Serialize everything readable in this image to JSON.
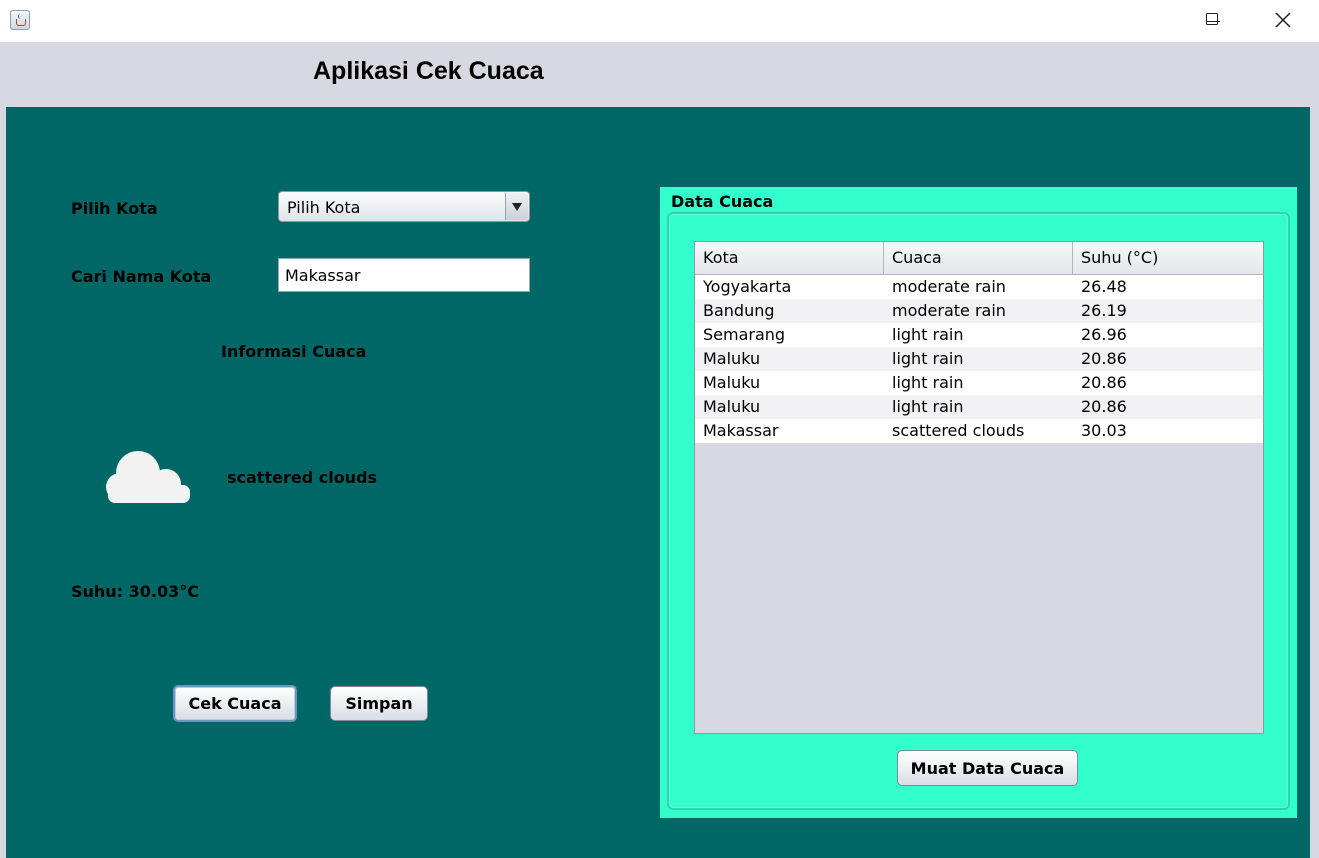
{
  "window": {
    "title": ""
  },
  "header": {
    "title": "Aplikasi Cek Cuaca"
  },
  "form": {
    "city_select_label": "Pilih Kota",
    "city_select_value": "Pilih Kota",
    "search_label": "Cari Nama Kota",
    "search_value": "Makassar"
  },
  "weather": {
    "section_label": "Informasi Cuaca",
    "icon": "cloud-icon",
    "description": "scattered clouds",
    "temperature": "Suhu: 30.03°C"
  },
  "actions": {
    "check_label": "Cek Cuaca",
    "save_label": "Simpan"
  },
  "data_panel": {
    "title": "Data Cuaca",
    "columns": [
      "Kota",
      "Cuaca",
      "Suhu (°C)"
    ],
    "rows": [
      [
        "Yogyakarta",
        "moderate rain",
        "26.48"
      ],
      [
        "Bandung",
        "moderate rain",
        "26.19"
      ],
      [
        "Semarang",
        "light rain",
        "26.96"
      ],
      [
        "Maluku",
        "light rain",
        "20.86"
      ],
      [
        "Maluku",
        "light rain",
        "20.86"
      ],
      [
        "Maluku",
        "light rain",
        "20.86"
      ],
      [
        "Makassar",
        "scattered clouds",
        "30.03"
      ]
    ],
    "load_label": "Muat Data Cuaca"
  },
  "colors": {
    "background": "#006767",
    "panel": "#33ffcc",
    "header": "#d6d9df"
  }
}
